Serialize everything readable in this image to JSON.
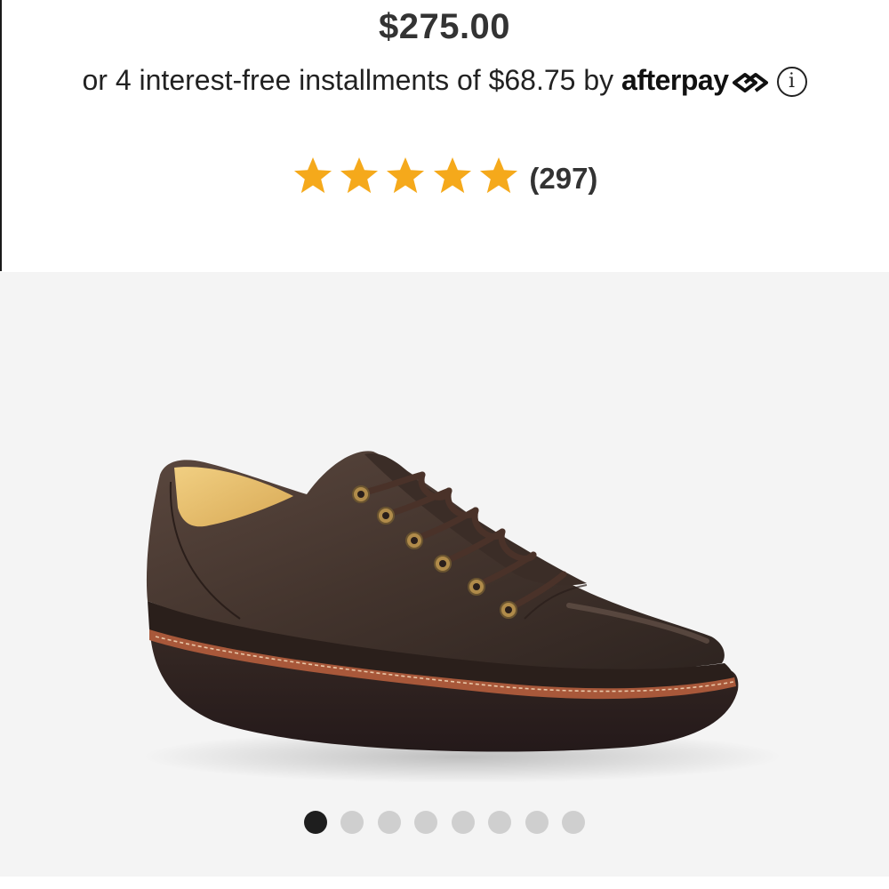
{
  "product": {
    "price": "$275.00",
    "installment_prefix": "or 4 interest-free installments of $68.75 by ",
    "afterpay_brand": "afterpay",
    "info_glyph": "i"
  },
  "rating": {
    "stars": 5,
    "max_stars": 5,
    "count_label": "(297)",
    "star_color": "#f5a91b"
  },
  "gallery": {
    "image_alt": "Brown leather lace-up shoe",
    "image_count": 8,
    "active_index": 0,
    "background": "#f4f4f4"
  }
}
